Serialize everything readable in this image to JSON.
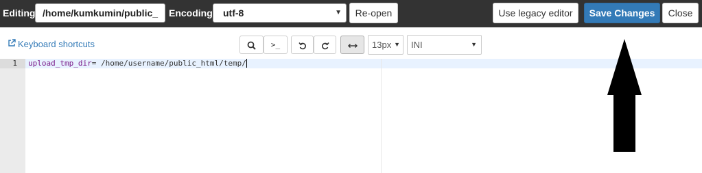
{
  "topbar": {
    "editing_label": "Editing:",
    "file_path": "/home/kumkumin/public_",
    "encoding_label": "Encoding:",
    "encoding_value": "utf-8",
    "reopen_label": "Re-open",
    "legacy_label": "Use legacy editor",
    "save_label": "Save Changes",
    "close_label": "Close"
  },
  "toolbar": {
    "keyboard_shortcuts": "Keyboard shortcuts",
    "font_size": "13px",
    "mode": "INI",
    "goto_label": ">_"
  },
  "editor": {
    "line_number": "1",
    "line_key": "upload_tmp_dir",
    "line_rest": "= /home/username/public_html/temp/"
  },
  "colors": {
    "topbar_bg": "#333333",
    "primary": "#337ab7",
    "link": "#337ab7",
    "key": "#7a1b8a"
  },
  "icons": [
    "external-link-icon",
    "search-icon",
    "undo-icon",
    "redo-icon",
    "wrap-toggle-icon",
    "chevron-down-icon",
    "annotation-arrow"
  ]
}
